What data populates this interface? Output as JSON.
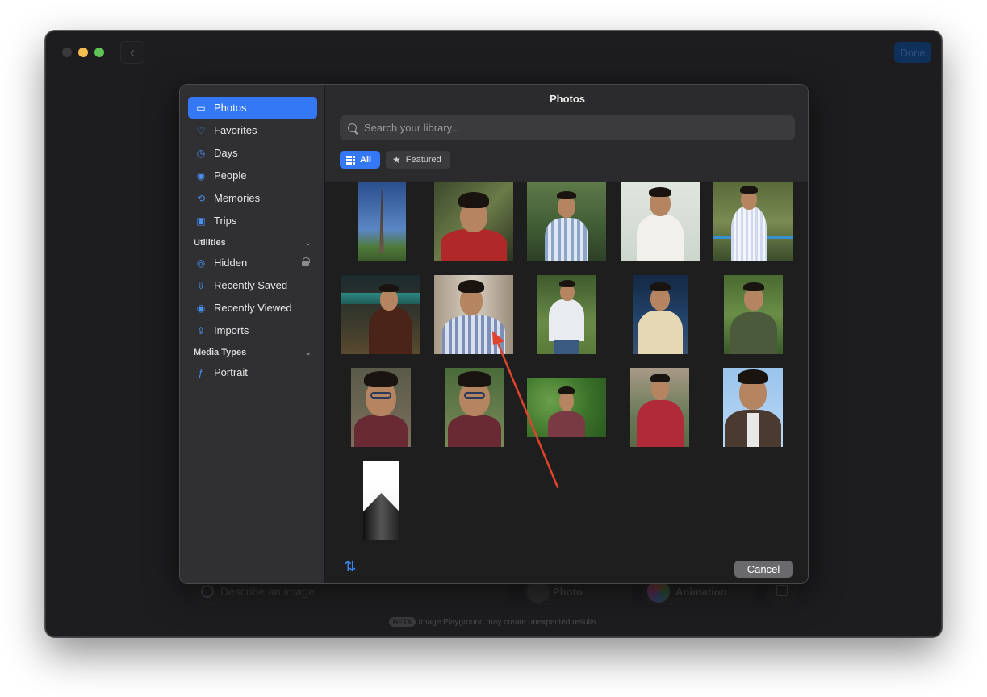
{
  "window": {
    "done_label": "Done",
    "back_glyph": "‹"
  },
  "background": {
    "describe_placeholder": "Describe an image",
    "photo_label": "Photo",
    "animation_label": "Animation",
    "beta_tag": "BETA",
    "beta_note": "Image Playground may create unexpected results."
  },
  "sidebar": {
    "items": [
      {
        "label": "Photos",
        "icon": "photos-icon",
        "glyph": "▭",
        "active": true
      },
      {
        "label": "Favorites",
        "icon": "heart-icon",
        "glyph": "♡"
      },
      {
        "label": "Days",
        "icon": "clock-icon",
        "glyph": "◷"
      },
      {
        "label": "People",
        "icon": "person-circle-icon",
        "glyph": "◉"
      },
      {
        "label": "Memories",
        "icon": "memories-icon",
        "glyph": "⟲"
      },
      {
        "label": "Trips",
        "icon": "suitcase-icon",
        "glyph": "▣"
      }
    ],
    "sections": [
      {
        "title": "Utilities",
        "items": [
          {
            "label": "Hidden",
            "icon": "eye-slash-icon",
            "glyph": "◎",
            "locked": true
          },
          {
            "label": "Recently Saved",
            "icon": "recently-saved-icon",
            "glyph": "⇩"
          },
          {
            "label": "Recently Viewed",
            "icon": "eye-icon",
            "glyph": "◉"
          },
          {
            "label": "Imports",
            "icon": "import-icon",
            "glyph": "⇪"
          }
        ]
      },
      {
        "title": "Media Types",
        "items": [
          {
            "label": "Portrait",
            "icon": "portrait-icon",
            "glyph": "ƒ"
          }
        ]
      }
    ]
  },
  "main": {
    "title": "Photos",
    "search_placeholder": "Search your library...",
    "filters": {
      "all": "All",
      "featured": "Featured"
    },
    "cancel_label": "Cancel",
    "sort_glyph": "⇅"
  },
  "colors": {
    "accent": "#3478f6",
    "sidebar_bg": "#303033",
    "annotation_arrow": "#e0442c"
  }
}
